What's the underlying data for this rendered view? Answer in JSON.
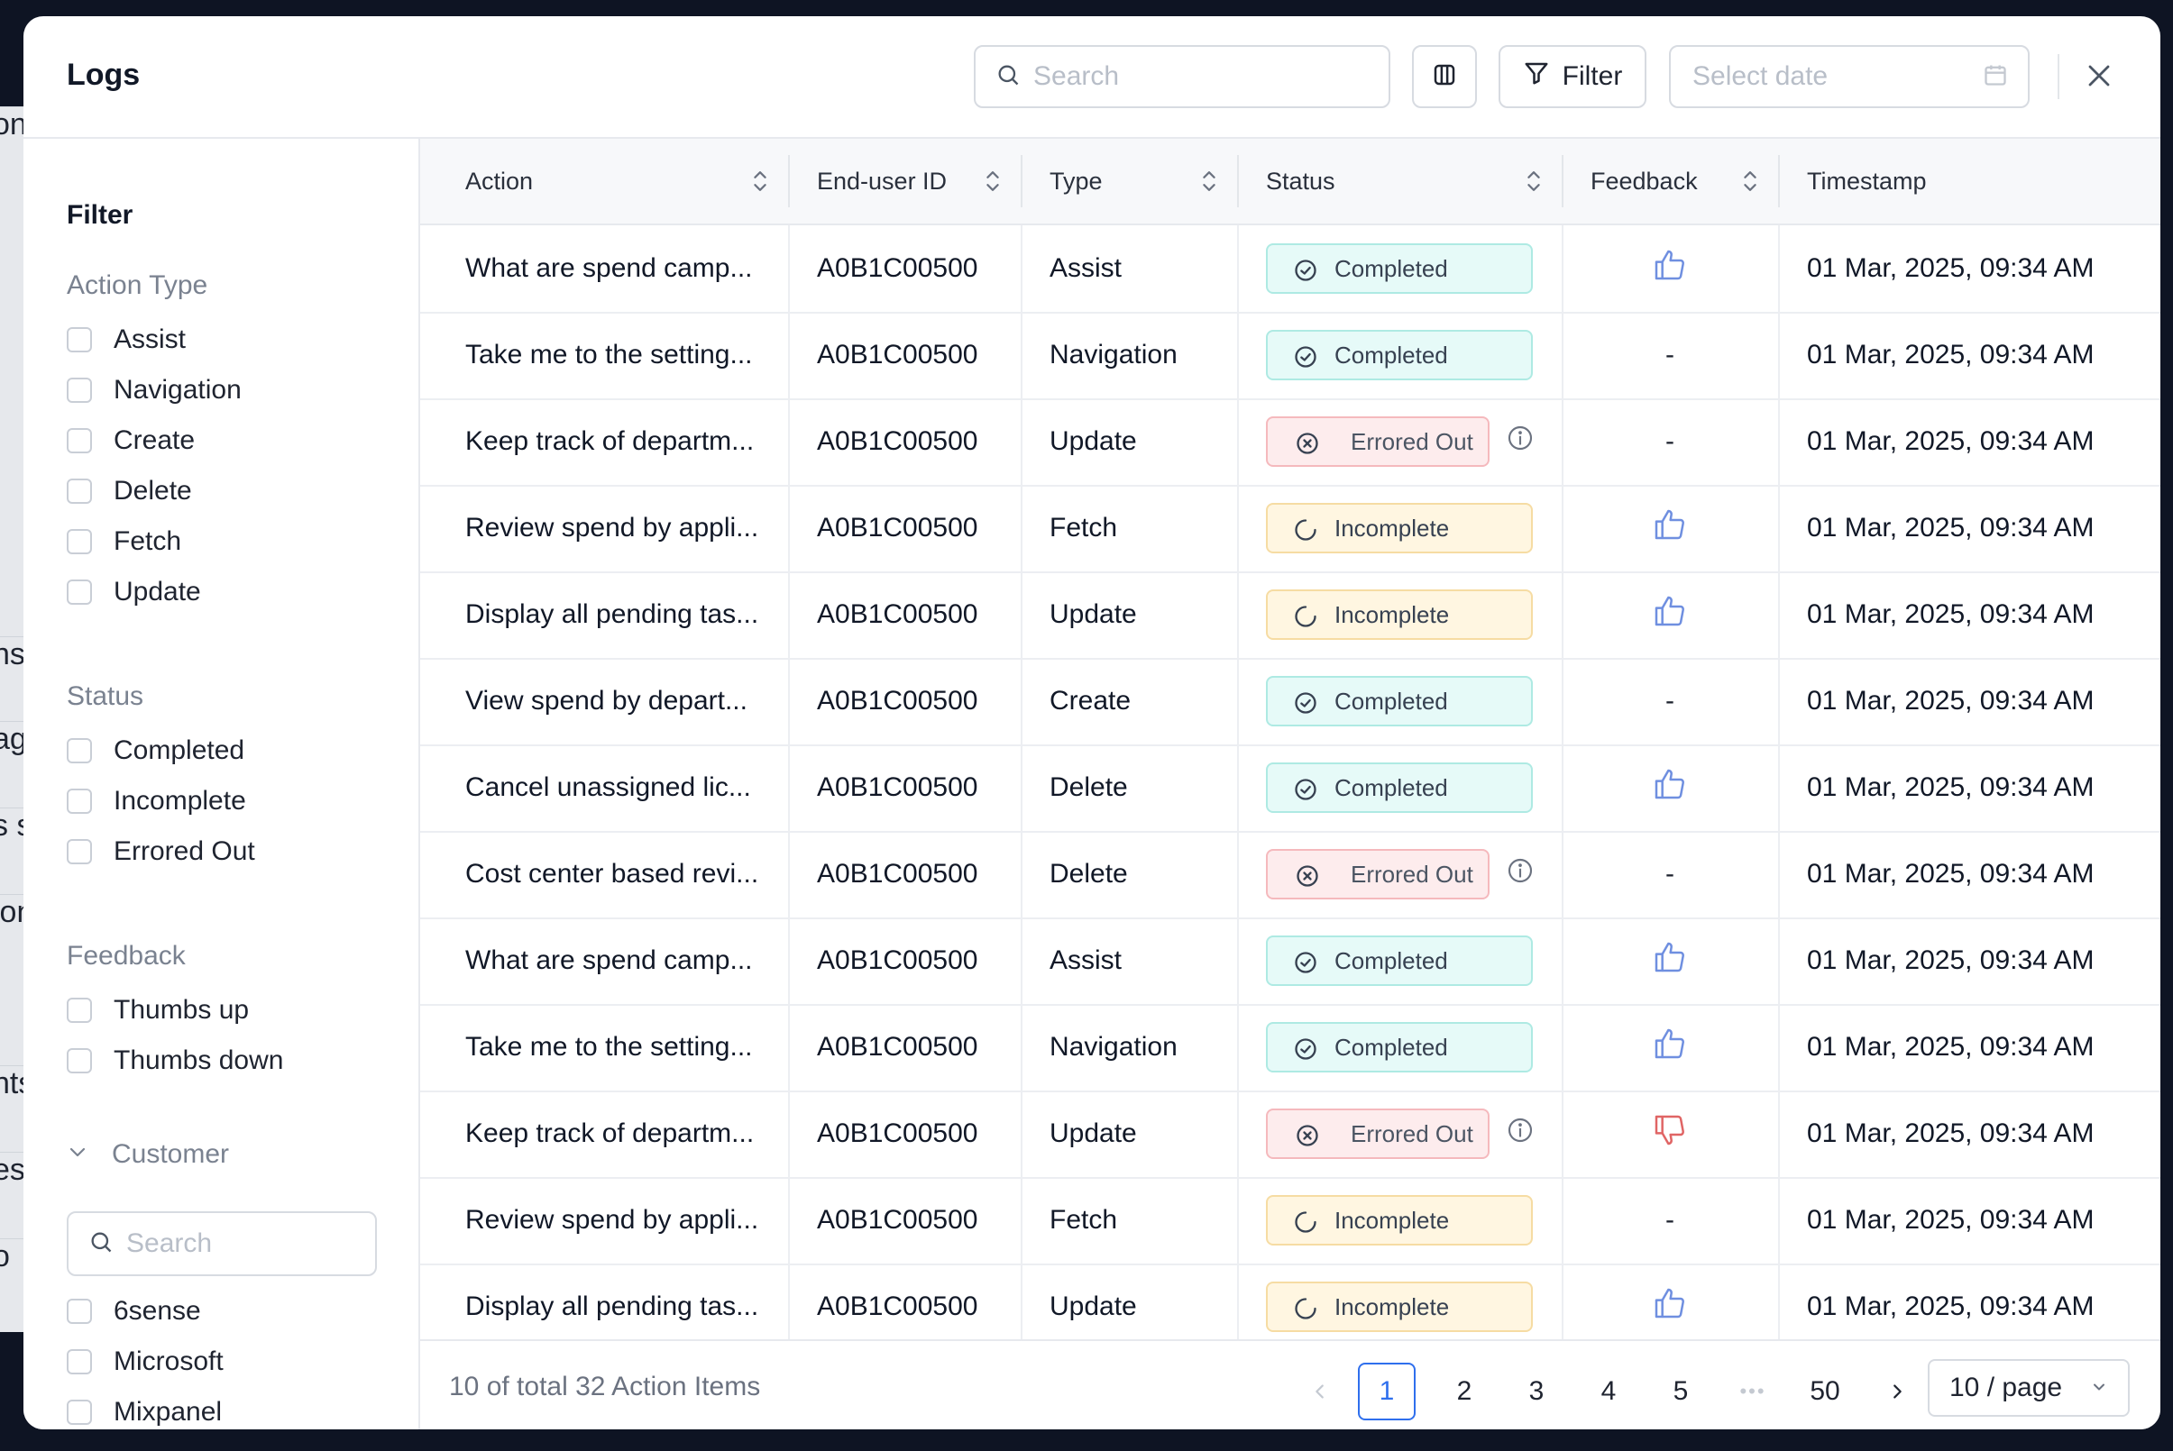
{
  "background_fragments": [
    "ons",
    "ns'",
    "ag",
    "s sp",
    "ion",
    "nts",
    "es",
    "o"
  ],
  "header": {
    "title": "Logs",
    "search_placeholder": "Search",
    "filter_label": "Filter",
    "date_placeholder": "Select date"
  },
  "sidebar": {
    "title": "Filter",
    "action_type": {
      "title": "Action Type",
      "options": [
        "Assist",
        "Navigation",
        "Create",
        "Delete",
        "Fetch",
        "Update"
      ]
    },
    "status": {
      "title": "Status",
      "options": [
        "Completed",
        "Incomplete",
        "Errored Out"
      ]
    },
    "feedback": {
      "title": "Feedback",
      "options": [
        "Thumbs up",
        "Thumbs down"
      ]
    },
    "customer": {
      "title": "Customer",
      "search_placeholder": "Search",
      "options": [
        "6sense",
        "Microsoft",
        "Mixpanel"
      ]
    }
  },
  "table": {
    "columns": [
      "Action",
      "End-user ID",
      "Type",
      "Status",
      "Feedback",
      "Timestamp"
    ],
    "rows": [
      {
        "action": "What are spend camp...",
        "user_id": "A0B1C00500",
        "type": "Assist",
        "status": "Completed",
        "feedback": "up",
        "timestamp": "01 Mar, 2025, 09:34 AM"
      },
      {
        "action": "Take me to the setting...",
        "user_id": "A0B1C00500",
        "type": "Navigation",
        "status": "Completed",
        "feedback": "-",
        "timestamp": "01 Mar, 2025, 09:34 AM"
      },
      {
        "action": "Keep track of departm...",
        "user_id": "A0B1C00500",
        "type": "Update",
        "status": "Errored Out",
        "feedback": "-",
        "timestamp": "01 Mar, 2025, 09:34 AM"
      },
      {
        "action": "Review spend by appli...",
        "user_id": "A0B1C00500",
        "type": "Fetch",
        "status": "Incomplete",
        "feedback": "up",
        "timestamp": "01 Mar, 2025, 09:34 AM"
      },
      {
        "action": "Display all pending tas...",
        "user_id": "A0B1C00500",
        "type": "Update",
        "status": "Incomplete",
        "feedback": "up",
        "timestamp": "01 Mar, 2025, 09:34 AM"
      },
      {
        "action": "View spend by depart...",
        "user_id": "A0B1C00500",
        "type": "Create",
        "status": "Completed",
        "feedback": "-",
        "timestamp": "01 Mar, 2025, 09:34 AM"
      },
      {
        "action": "Cancel unassigned lic...",
        "user_id": "A0B1C00500",
        "type": "Delete",
        "status": "Completed",
        "feedback": "up",
        "timestamp": "01 Mar, 2025, 09:34 AM"
      },
      {
        "action": "Cost center based revi...",
        "user_id": "A0B1C00500",
        "type": "Delete",
        "status": "Errored Out",
        "feedback": "-",
        "timestamp": "01 Mar, 2025, 09:34 AM"
      },
      {
        "action": "What are spend camp...",
        "user_id": "A0B1C00500",
        "type": "Assist",
        "status": "Completed",
        "feedback": "up",
        "timestamp": "01 Mar, 2025, 09:34 AM"
      },
      {
        "action": "Take me to the setting...",
        "user_id": "A0B1C00500",
        "type": "Navigation",
        "status": "Completed",
        "feedback": "up",
        "timestamp": "01 Mar, 2025, 09:34 AM"
      },
      {
        "action": "Keep track of departm...",
        "user_id": "A0B1C00500",
        "type": "Update",
        "status": "Errored Out",
        "feedback": "down",
        "timestamp": "01 Mar, 2025, 09:34 AM"
      },
      {
        "action": "Review spend by appli...",
        "user_id": "A0B1C00500",
        "type": "Fetch",
        "status": "Incomplete",
        "feedback": "-",
        "timestamp": "01 Mar, 2025, 09:34 AM"
      },
      {
        "action": "Display all pending tas...",
        "user_id": "A0B1C00500",
        "type": "Update",
        "status": "Incomplete",
        "feedback": "up",
        "timestamp": "01 Mar, 2025, 09:34 AM"
      }
    ]
  },
  "footer": {
    "summary": "10 of total 32 Action Items",
    "pages": [
      "1",
      "2",
      "3",
      "4",
      "5"
    ],
    "ellipsis": "•••",
    "last_page": "50",
    "current_page": "1",
    "page_size": "10 / page"
  },
  "colors": {
    "accent": "#2f6fed",
    "completed_bg": "#e6faf8",
    "incomplete_bg": "#fff6e1",
    "error_bg": "#fdeced",
    "thumb_up": "#6f8fe0",
    "thumb_down": "#e06565"
  },
  "icons": {
    "search": "search-icon",
    "columns": "columns-icon",
    "filter": "filter-icon",
    "calendar": "calendar-icon",
    "close": "close-icon",
    "sort": "sort-icon",
    "thumbs_up": "thumbs-up-icon",
    "thumbs_down": "thumbs-down-icon",
    "info": "info-icon",
    "chevron_down": "chevron-down-icon"
  }
}
